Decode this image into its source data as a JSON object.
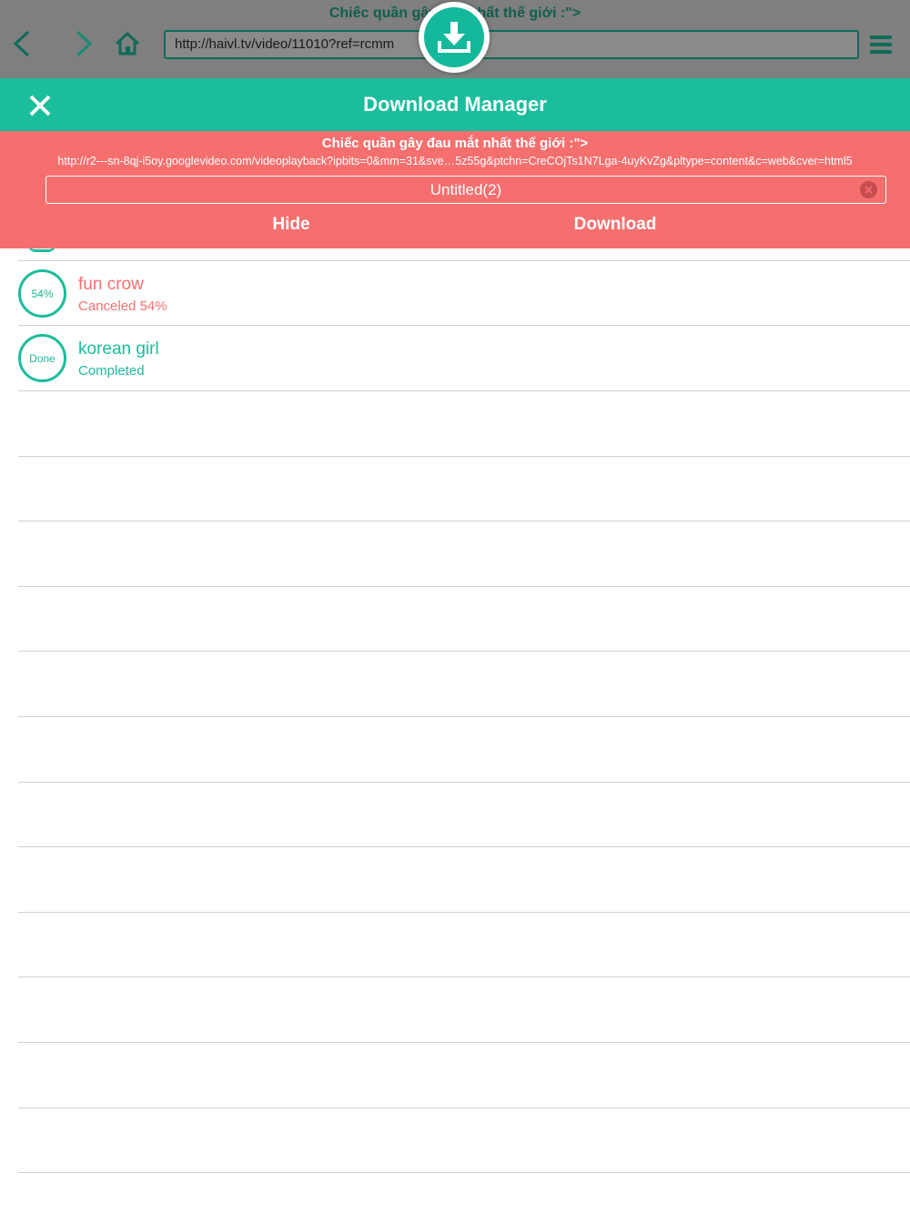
{
  "browser": {
    "page_title": "Chiếc quần gây đ… nhất thế giới :\">",
    "url": "http://haivl.tv/video/11010?ref=rcmm",
    "colors": {
      "accent": "#0f6b58"
    }
  },
  "download_manager": {
    "title": "Download Manager",
    "colors": {
      "header": "#1abd9c",
      "pending": "#f56f6f"
    }
  },
  "pending": {
    "title": "Chiếc quần gây đau mắt nhất thế giới :\">",
    "url": "http://r2---sn-8qj-i5oy.googlevideo.com/videoplayback?ipbits=0&mm=31&sve…5z55g&ptchn=CreCOjTs1N7Lga-4uyKvZg&pltype=content&c=web&cver=html5",
    "filename": "Untitled(2)",
    "hide_label": "Hide",
    "download_label": "Download"
  },
  "downloads": [
    {
      "name": "fun crow",
      "status": "Canceled 54%",
      "ring": "54%",
      "state": "canceled"
    },
    {
      "name": "korean girl",
      "status": "Completed",
      "ring": "Done",
      "state": "completed"
    }
  ]
}
